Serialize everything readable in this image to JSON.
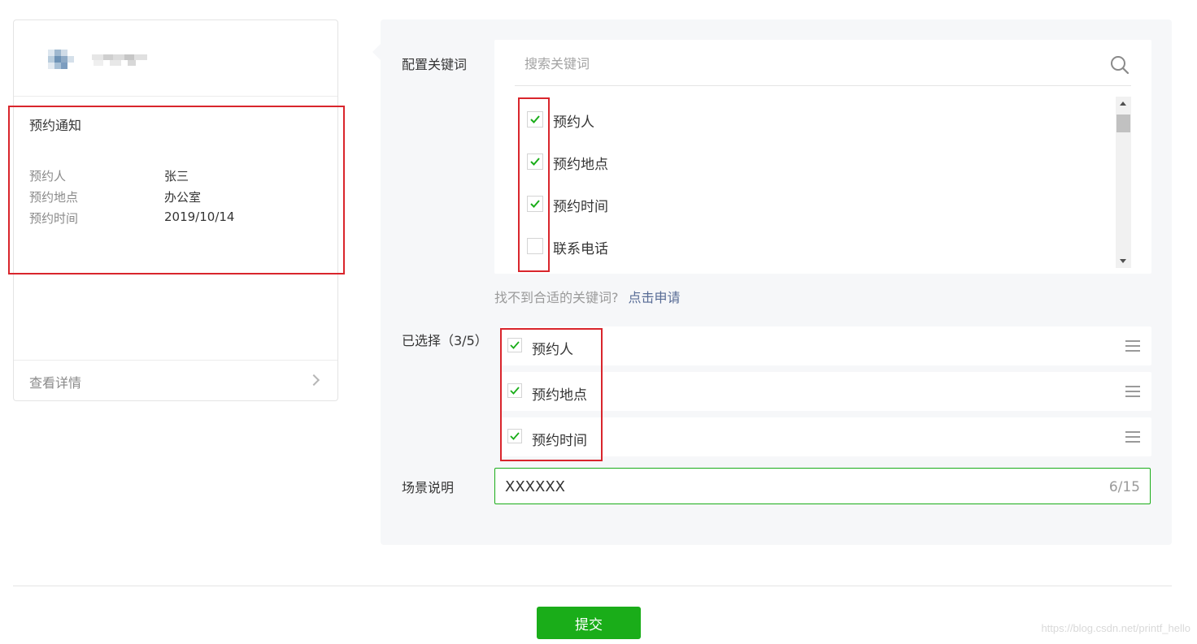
{
  "preview": {
    "title": "预约通知",
    "rows": [
      {
        "key": "预约人",
        "value": "张三"
      },
      {
        "key": "预约地点",
        "value": "办公室"
      },
      {
        "key": "预约时间",
        "value": "2019/10/14"
      }
    ],
    "footer_label": "查看详情"
  },
  "config": {
    "keywords_label": "配置关键词",
    "search_placeholder": "搜索关键词",
    "keyword_options": [
      {
        "label": "预约人",
        "checked": true
      },
      {
        "label": "预约地点",
        "checked": true
      },
      {
        "label": "预约时间",
        "checked": true
      },
      {
        "label": "联系电话",
        "checked": false
      }
    ],
    "hint_text": "找不到合适的关键词?",
    "hint_link": "点击申请",
    "selected_label": "已选择（3/5）",
    "selected_items": [
      "预约人",
      "预约地点",
      "预约时间"
    ],
    "scene_label": "场景说明",
    "scene_value": "XXXXXX",
    "scene_counter": "6/15"
  },
  "submit_label": "提交",
  "watermark": "https://blog.csdn.net/printf_hello",
  "colors": {
    "accent": "#1aad19",
    "link": "#576b95",
    "highlight": "#d9252c",
    "panel": "#f6f7f9"
  }
}
